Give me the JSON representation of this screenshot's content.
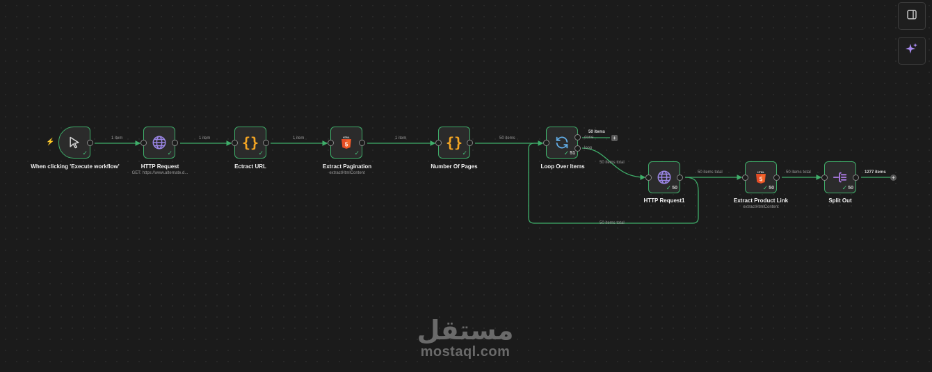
{
  "nodes": {
    "trigger": {
      "title": "When clicking 'Execute workflow'"
    },
    "http": {
      "title": "HTTP Request",
      "subtitle": "GET: https://www.alternate.d..."
    },
    "extract_url": {
      "title": "Ectract URL"
    },
    "extract_pagination": {
      "title": "Extract Pagination",
      "subtitle": "extractHtmlContent"
    },
    "number_pages": {
      "title": "Number Of Pages"
    },
    "loop": {
      "title": "Loop Over Items",
      "count": "51",
      "output_done": "done",
      "output_loop": "loop"
    },
    "http1": {
      "title": "HTTP Request1",
      "count": "50"
    },
    "extract_link": {
      "title": "Extract Product Link",
      "subtitle": "extractHtmlContent",
      "count": "50"
    },
    "split": {
      "title": "Split Out",
      "count": "50"
    }
  },
  "edges": {
    "e1": "1 item",
    "e2": "1 item",
    "e3": "1 item",
    "e4": "1 item",
    "e5": "50 items",
    "done_out": "50 items",
    "loop_http1": "50 items total",
    "http1_extract": "50 items total",
    "extract_split": "50 items total",
    "split_out": "1277 items",
    "back_loop": "50 items total"
  },
  "toolbar": {
    "panel_icon": "panel-toggle-icon",
    "ai_icon": "sparkle-icon"
  },
  "watermark": {
    "arabic": "مستقل",
    "latin": "mostaql.com"
  },
  "colors": {
    "success": "#3fae6a",
    "canvas": "#1b1b1b",
    "trigger_accent": "#ff6d3a",
    "code_accent": "#f5a623",
    "globe": "#9b86e6",
    "loop": "#62aee8"
  }
}
